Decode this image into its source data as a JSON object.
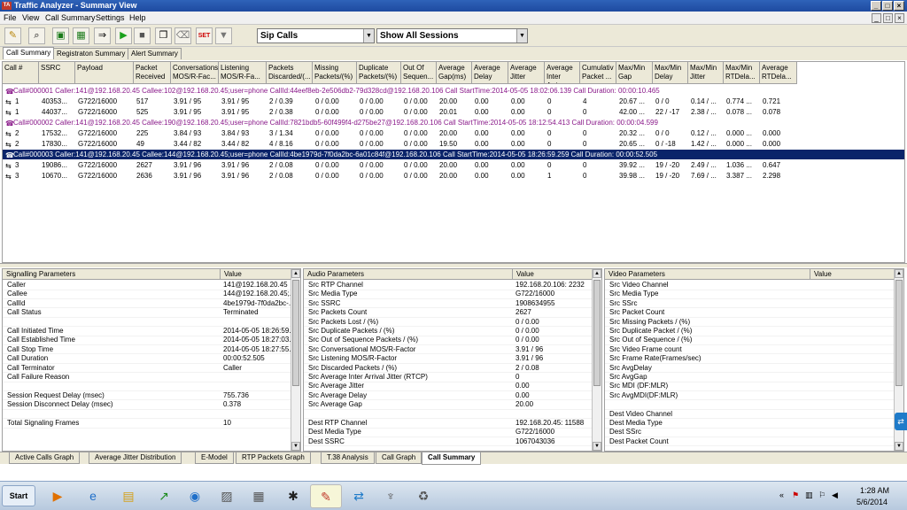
{
  "window": {
    "title": "Traffic Analyzer - Summary View",
    "app_icon_text": "TA",
    "controls": [
      "_",
      "□",
      "×"
    ],
    "mdi_controls": [
      "_",
      "□",
      "×"
    ]
  },
  "menu": [
    "File",
    "View",
    "Call Summary",
    "Settings",
    "Help"
  ],
  "toolbar": {
    "buttons": [
      "open-icon",
      "search-icon",
      "export-icon",
      "stats-icon",
      "forward-icon",
      "play-icon",
      "stop-icon",
      "copy-icon",
      "clear-icon",
      "set-icon",
      "filter-icon"
    ],
    "set_label": "SET",
    "protocol_select": "Sip Calls",
    "session_select": "Show All Sessions"
  },
  "view_tabs": [
    "Call Summary",
    "Registraton Summary",
    "Alert Summary"
  ],
  "grid": {
    "columns": [
      "Call #",
      "SSRC",
      "Payload",
      "Packet Received",
      "Conversations MOS/R-Fac...",
      "Listening MOS/R-Fa...",
      "Packets Discarded/(...",
      "Missing Packets/(%)",
      "Duplicate Packets/(%)",
      "Out Of Sequen...",
      "Average Gap(ms)",
      "Average Delay",
      "Average Jitter",
      "Average Inter Arri...",
      "Cumulativ Packet ...",
      "Max/Min Gap",
      "Max/Min Delay",
      "Max/Min Jitter",
      "Max/Min RTDela...",
      "Average RTDela..."
    ],
    "calls": [
      {
        "header": "Call#000001  Caller:141@192.168.20.45  Callee:102@192.168.20.45;user=phone CallId:44eef8eb-2e506db2-79d328cd@192.168.20.106 Call StartTime:2014-05-05 18:02:06.139 Call Duration: 00:00:10.465",
        "selected": false,
        "streams": [
          [
            "1",
            "40353...",
            "G722/16000",
            "517",
            "3.91 / 95",
            "3.91 / 95",
            "2 / 0.39",
            "0 / 0.00",
            "0 / 0.00",
            "0 / 0.00",
            "20.00",
            "0.00",
            "0.00",
            "0",
            "4",
            "20.67 ...",
            "0 / 0",
            "0.14 / ...",
            "0.774 ...",
            "0.721"
          ],
          [
            "1",
            "44037...",
            "G722/16000",
            "525",
            "3.91 / 95",
            "3.91 / 95",
            "2 / 0.38",
            "0 / 0.00",
            "0 / 0.00",
            "0 / 0.00",
            "20.01",
            "0.00",
            "0.00",
            "0",
            "0",
            "42.00 ...",
            "22 / -17",
            "2.38 / ...",
            "0.078 ...",
            "0.078"
          ]
        ]
      },
      {
        "header": "Call#000002  Caller:141@192.168.20.45  Callee:190@192.168.20.45;user=phone CallId:7821bdb5-60f499f4-d275be27@192.168.20.106 Call StartTime:2014-05-05 18:12:54.413 Call Duration: 00:00:04.599",
        "selected": false,
        "streams": [
          [
            "2",
            "17532...",
            "G722/16000",
            "225",
            "3.84 / 93",
            "3.84 / 93",
            "3 / 1.34",
            "0 / 0.00",
            "0 / 0.00",
            "0 / 0.00",
            "20.00",
            "0.00",
            "0.00",
            "0",
            "0",
            "20.32 ...",
            "0 / 0",
            "0.12 / ...",
            "0.000 ...",
            "0.000"
          ],
          [
            "2",
            "17830...",
            "G722/16000",
            "49",
            "3.44 / 82",
            "3.44 / 82",
            "4 / 8.16",
            "0 / 0.00",
            "0 / 0.00",
            "0 / 0.00",
            "19.50",
            "0.00",
            "0.00",
            "0",
            "0",
            "20.65 ...",
            "0 / -18",
            "1.42 / ...",
            "0.000 ...",
            "0.000"
          ]
        ]
      },
      {
        "header": "Call#000003  Caller:141@192.168.20.45  Callee:144@192.168.20.45;user=phone CallId:4be1979d-7f0da2bc-6a01c84f@192.168.20.106 Call StartTime:2014-05-05 18:26:59.259 Call Duration: 00:00:52.505",
        "selected": true,
        "streams": [
          [
            "3",
            "19086...",
            "G722/16000",
            "2627",
            "3.91 / 96",
            "3.91 / 96",
            "2 / 0.08",
            "0 / 0.00",
            "0 / 0.00",
            "0 / 0.00",
            "20.00",
            "0.00",
            "0.00",
            "0",
            "0",
            "39.92 ...",
            "19 / -20",
            "2.49 / ...",
            "1.036 ...",
            "0.647"
          ],
          [
            "3",
            "10670...",
            "G722/16000",
            "2636",
            "3.91 / 96",
            "3.91 / 96",
            "2 / 0.08",
            "0 / 0.00",
            "0 / 0.00",
            "0 / 0.00",
            "20.00",
            "0.00",
            "0.00",
            "1",
            "0",
            "39.98 ...",
            "19 / -20",
            "7.69 / ...",
            "3.387 ...",
            "2.298"
          ]
        ]
      }
    ]
  },
  "signalling": {
    "headers": [
      "Signalling Parameters",
      "Value"
    ],
    "rows": [
      [
        "Caller",
        "141@192.168.20.45"
      ],
      [
        "Callee",
        "144@192.168.20.45;..."
      ],
      [
        "CallId",
        "4be1979d-7f0da2bc-..."
      ],
      [
        "Call Status",
        "Terminated"
      ],
      [
        "",
        ""
      ],
      [
        "Call Initiated Time",
        "2014-05-05 18:26:59...."
      ],
      [
        "Call Established Time",
        "2014-05-05 18:27:03...."
      ],
      [
        "Call Stop Time",
        "2014-05-05 18:27:55...."
      ],
      [
        "Call Duration",
        "00:00:52.505"
      ],
      [
        "Call Terminator",
        "Caller"
      ],
      [
        "Call Failure Reason",
        ""
      ],
      [
        "",
        ""
      ],
      [
        "Session Request Delay (msec)",
        "755.736"
      ],
      [
        "Session Disconnect Delay (msec)",
        "0.378"
      ],
      [
        "",
        ""
      ],
      [
        "Total Signaling Frames",
        "10"
      ]
    ]
  },
  "audio": {
    "headers": [
      "Audio Parameters",
      "Value"
    ],
    "rows": [
      [
        "Src RTP Channel",
        "192.168.20.106: 2232"
      ],
      [
        "Src Media Type",
        "G722/16000"
      ],
      [
        "Src SSRC",
        "1908634955"
      ],
      [
        "Src Packets Count",
        "2627"
      ],
      [
        "Src Packets Lost / (%)",
        "0 / 0.00"
      ],
      [
        "Src Duplicate Packets / (%)",
        "0 / 0.00"
      ],
      [
        "Src Out of Sequence Packets / (%)",
        "0 / 0.00"
      ],
      [
        "Src Conversational MOS/R-Factor",
        "3.91 / 96"
      ],
      [
        "Src Listening MOS/R-Factor",
        "3.91 / 96"
      ],
      [
        "Src Discarded Packets / (%)",
        "2 / 0.08"
      ],
      [
        "Src Average Inter Arrival Jitter (RTCP)",
        "0"
      ],
      [
        "Src Average Jitter",
        "0.00"
      ],
      [
        "Src Average Delay",
        "0.00"
      ],
      [
        "Src Average Gap",
        "20.00"
      ],
      [
        "",
        ""
      ],
      [
        "Dest RTP Channel",
        "192.168.20.45: 11588"
      ],
      [
        "Dest Media Type",
        "G722/16000"
      ],
      [
        "Dest SSRC",
        "1067043036"
      ]
    ]
  },
  "video": {
    "headers": [
      "Video Parameters",
      "Value"
    ],
    "rows": [
      [
        "Src Video Channel",
        ""
      ],
      [
        "Src Media Type",
        ""
      ],
      [
        "Src SSrc",
        ""
      ],
      [
        "Src Packet Count",
        ""
      ],
      [
        "Src Missing Packets / (%)",
        ""
      ],
      [
        "Src Duplicate Packet / (%)",
        ""
      ],
      [
        "Src Out of Sequence / (%)",
        ""
      ],
      [
        "Src Video Frame count",
        ""
      ],
      [
        "Src Frame Rate(Frames/sec)",
        ""
      ],
      [
        "Src AvgDelay",
        ""
      ],
      [
        "Src AvgGap",
        ""
      ],
      [
        "Src MDI (DF:MLR)",
        ""
      ],
      [
        "Src AvgMDI(DF:MLR)",
        ""
      ],
      [
        "",
        ""
      ],
      [
        "Dest Video Channel",
        ""
      ],
      [
        "Dest Media Type",
        ""
      ],
      [
        "Dest SSrc",
        ""
      ],
      [
        "Dest Packet Count",
        ""
      ]
    ]
  },
  "bottom_tabs": [
    "Active Calls Graph",
    "Average Jitter Distribution",
    "E-Model",
    "RTP Packets Graph",
    "T.38 Analysis",
    "Call Graph",
    "Call Summary"
  ],
  "bottom_active": "Call Summary",
  "taskbar": {
    "start": "Start",
    "apps": [
      "media-player-icon",
      "ie-icon",
      "folder-icon",
      "stock-chart-icon",
      "network-icon",
      "paint-icon",
      "calculator-icon",
      "vlc-icon",
      "traffic-analyzer-icon",
      "teamviewer-icon",
      "satellite-icon",
      "recycle-icon"
    ],
    "clock_time": "1:28 AM",
    "clock_date": "5/6/2014"
  },
  "colors": {
    "title_bar": "#1e4aa0",
    "call_header_text": "#8a1a8a",
    "selected_row": "#0a246a"
  }
}
